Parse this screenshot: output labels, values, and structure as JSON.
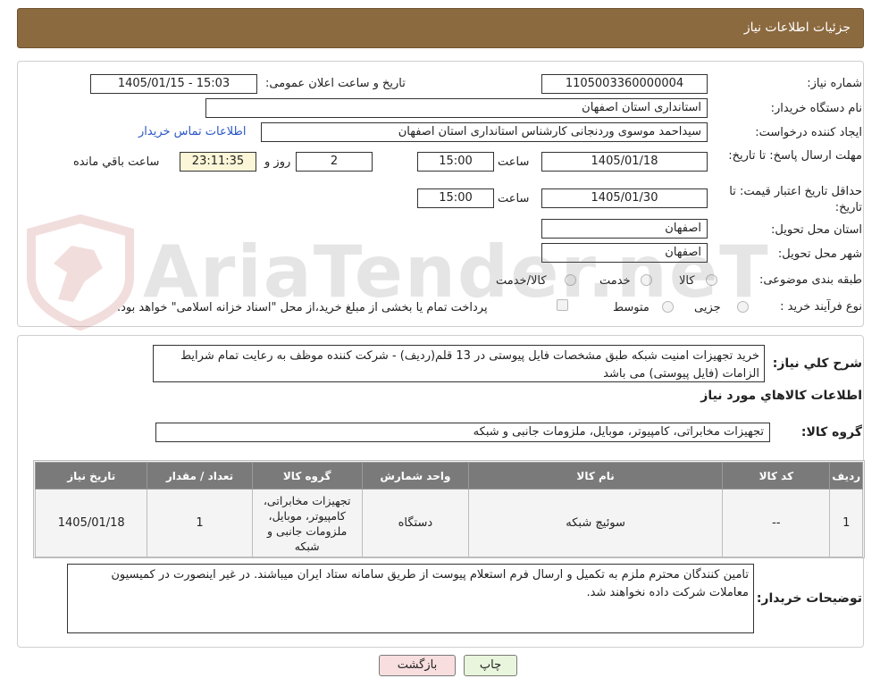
{
  "header": {
    "title": "جزئیات اطلاعات نیاز"
  },
  "form": {
    "need_number_label": "شماره نیاز:",
    "need_number": "1105003360000004",
    "announce_label": "تاریخ و ساعت اعلان عمومی:",
    "announce_value": "1405/01/15 - 15:03",
    "buyer_org_label": "نام دستگاه خریدار:",
    "buyer_org": "استانداری استان اصفهان",
    "creator_label": "ایجاد کننده درخواست:",
    "creator": "سیداحمد موسوی وردنجانی کارشناس استانداری استان اصفهان",
    "contact_link": "اطلاعات تماس خریدار",
    "deadline_label": "مهلت ارسال پاسخ: تا تاریخ:",
    "deadline_date": "1405/01/18",
    "time_label": "ساعت",
    "deadline_time": "15:00",
    "days_value": "2",
    "days_label": "روز و",
    "remaining_time": "23:11:35",
    "remaining_label": "ساعت باقي مانده",
    "validity_label": "حداقل تاریخ اعتبار قیمت: تا تاریخ:",
    "validity_date": "1405/01/30",
    "validity_time": "15:00",
    "province_label": "استان محل تحویل:",
    "province": "اصفهان",
    "city_label": "شهر محل تحویل:",
    "city": "اصفهان",
    "category_label": "طبقه بندی موضوعی:",
    "category_options": [
      "کالا",
      "خدمت",
      "کالا/خدمت"
    ],
    "process_label": "نوع فرآیند خرید :",
    "process_options": [
      "جزیی",
      "متوسط"
    ],
    "payment_note": "پرداخت تمام یا بخشی از مبلغ خرید،از محل \"اسناد خزانه اسلامی\" خواهد بود."
  },
  "watermark": {
    "text": "AriaTender.neT"
  },
  "details": {
    "summary_label": "شرح کلي نياز:",
    "summary_text": "خرید تجهیزات امنیت شبکه طبق مشخصات فایل پیوستی در 13 قلم(ردیف) - شرکت کننده موظف به رعایت تمام شرایط الزامات (فایل پیوستی) می باشد",
    "goods_info_title": "اطلاعات کالاهاي مورد نياز",
    "goods_group_label": "گروه کالا:",
    "goods_group": "تجهیزات مخابراتی، کامپیوتر، موبایل، ملزومات جانبی و شبکه",
    "table": {
      "headers": [
        "ردیف",
        "کد کالا",
        "نام کالا",
        "واحد شمارش",
        "گروه کالا",
        "تعداد / مقدار",
        "تاریخ نیاز"
      ],
      "rows": [
        {
          "row": "1",
          "code": "--",
          "name": "سوئیچ شبکه",
          "unit": "دستگاه",
          "group": "تجهیزات مخابراتی، کامپیوتر، موبایل، ملزومات جانبی و شبکه",
          "qty": "1",
          "date": "1405/01/18"
        }
      ]
    },
    "buyer_notes_label": "توضیحات خریدار:",
    "buyer_notes": "تامین کنندگان محترم ملزم به تکمیل و ارسال فرم استعلام پیوست از طریق سامانه ستاد ایران میباشند. در غیر اینصورت در کمیسیون معاملات شرکت داده نخواهند شد."
  },
  "buttons": {
    "print": "چاپ",
    "back": "بازگشت"
  }
}
